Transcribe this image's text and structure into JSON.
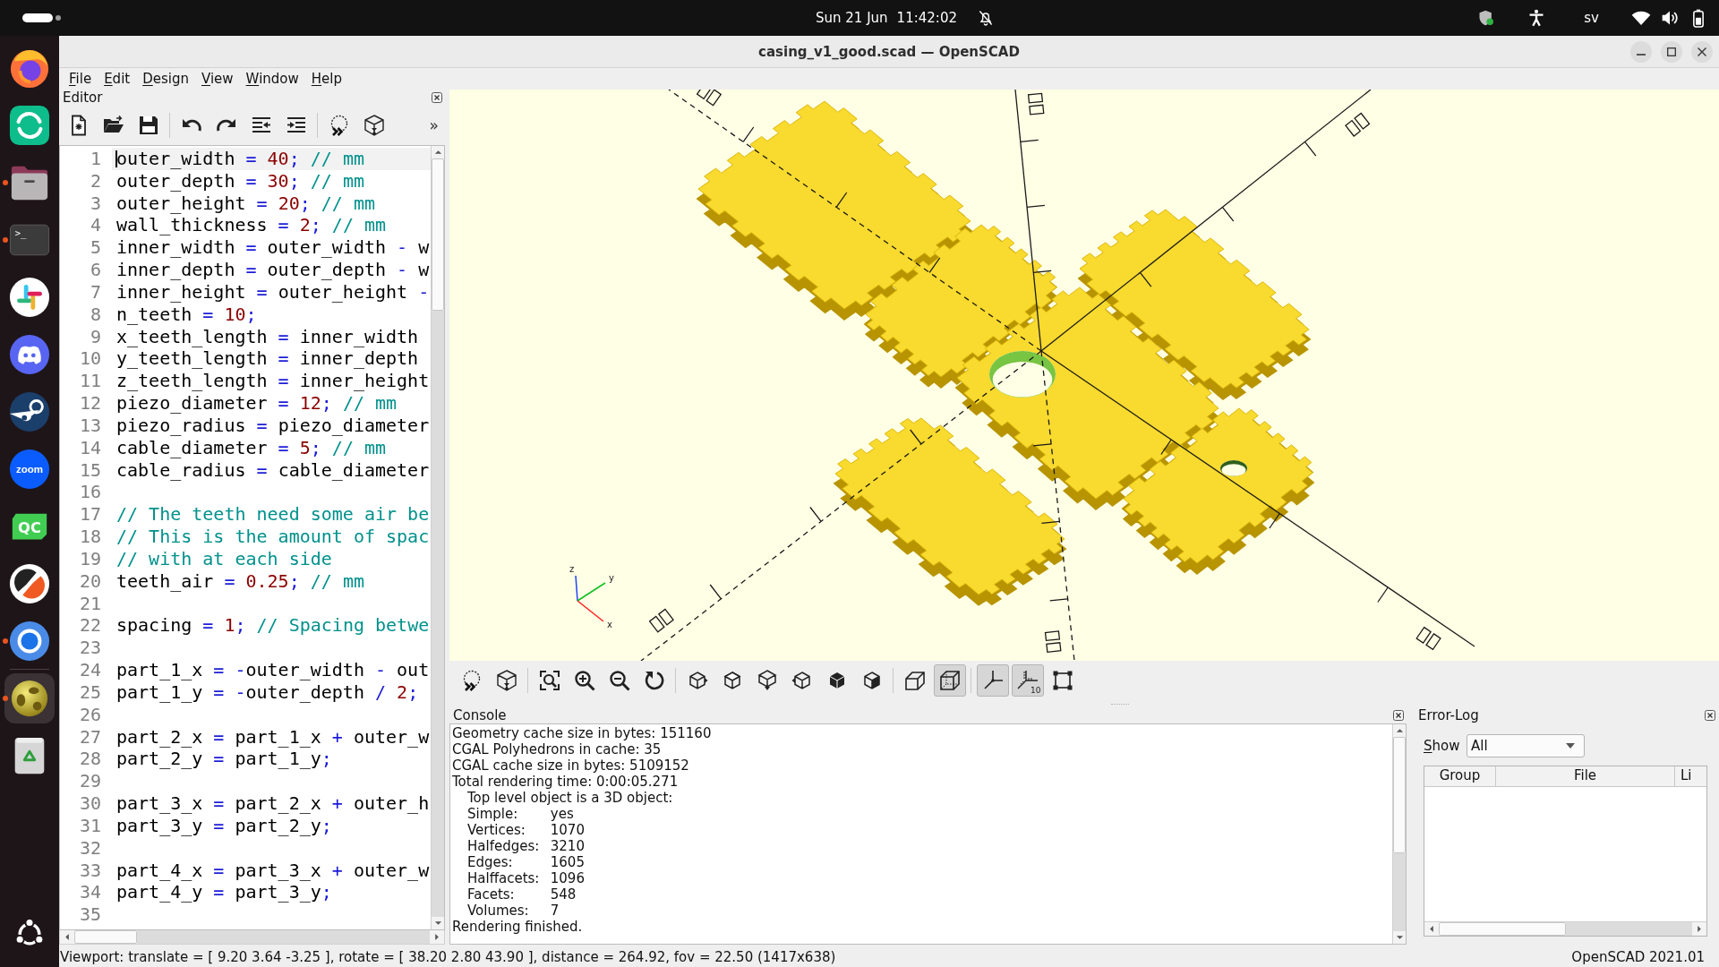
{
  "top_bar": {
    "date": "Sun 21 Jun",
    "time": "11:42:02",
    "keyboard_layout": "sv"
  },
  "dock": [
    {
      "kind": "flame",
      "running": false,
      "selected": false
    },
    {
      "kind": "rings",
      "running": false,
      "selected": false
    },
    {
      "kind": "folder",
      "running": true,
      "selected": false
    },
    {
      "kind": "terminal",
      "label": ">_",
      "running": true,
      "selected": false
    },
    {
      "kind": "pinwheel",
      "running": false,
      "selected": false
    },
    {
      "kind": "gamepad",
      "running": false,
      "selected": false
    },
    {
      "kind": "piston",
      "running": false,
      "selected": false
    },
    {
      "kind": "bubble",
      "label": "zoom",
      "running": false,
      "selected": false
    },
    {
      "kind": "flag",
      "label": "QC",
      "running": false,
      "selected": false
    },
    {
      "kind": "halfdisc",
      "running": false,
      "selected": false
    },
    {
      "kind": "orb",
      "running": true,
      "selected": false
    },
    {
      "kind": "sphere",
      "running": true,
      "selected": true
    },
    {
      "kind": "trash",
      "running": false,
      "selected": false
    }
  ],
  "window": {
    "title": "casing_v1_good.scad — OpenSCAD"
  },
  "menu": [
    "File",
    "Edit",
    "Design",
    "View",
    "Window",
    "Help"
  ],
  "editor": {
    "title": "Editor",
    "toolbar": [
      {
        "buttons": [
          {
            "kind": "new"
          },
          {
            "kind": "open"
          },
          {
            "kind": "save"
          }
        ]
      },
      {
        "buttons": [
          {
            "kind": "undo"
          },
          {
            "kind": "redo"
          },
          {
            "kind": "unindent"
          },
          {
            "kind": "indent"
          }
        ]
      },
      {
        "buttons": [
          {
            "kind": "preview"
          },
          {
            "kind": "render"
          }
        ]
      }
    ],
    "overflow": "»",
    "lines": [
      {
        "number": "1",
        "current": true,
        "tokens": [
          {
            "kind": "plain",
            "text": "outer_width"
          },
          {
            "kind": "op",
            "text": " = "
          },
          {
            "kind": "num",
            "text": "40"
          },
          {
            "kind": "op",
            "text": "; "
          },
          {
            "kind": "comment",
            "text": "// mm"
          }
        ]
      },
      {
        "number": "2",
        "current": false,
        "tokens": [
          {
            "kind": "plain",
            "text": "outer_depth"
          },
          {
            "kind": "op",
            "text": " = "
          },
          {
            "kind": "num",
            "text": "30"
          },
          {
            "kind": "op",
            "text": "; "
          },
          {
            "kind": "comment",
            "text": "// mm"
          }
        ]
      },
      {
        "number": "3",
        "current": false,
        "tokens": [
          {
            "kind": "plain",
            "text": "outer_height"
          },
          {
            "kind": "op",
            "text": " = "
          },
          {
            "kind": "num",
            "text": "20"
          },
          {
            "kind": "op",
            "text": "; "
          },
          {
            "kind": "comment",
            "text": "// mm"
          }
        ]
      },
      {
        "number": "4",
        "current": false,
        "tokens": [
          {
            "kind": "plain",
            "text": "wall_thickness"
          },
          {
            "kind": "op",
            "text": " = "
          },
          {
            "kind": "num",
            "text": "2"
          },
          {
            "kind": "op",
            "text": "; "
          },
          {
            "kind": "comment",
            "text": "// mm"
          }
        ]
      },
      {
        "number": "5",
        "current": false,
        "tokens": [
          {
            "kind": "plain",
            "text": "inner_width"
          },
          {
            "kind": "op",
            "text": " = "
          },
          {
            "kind": "plain",
            "text": "outer_width"
          },
          {
            "kind": "op",
            "text": " - "
          },
          {
            "kind": "plain",
            "text": "w"
          }
        ]
      },
      {
        "number": "6",
        "current": false,
        "tokens": [
          {
            "kind": "plain",
            "text": "inner_depth"
          },
          {
            "kind": "op",
            "text": " = "
          },
          {
            "kind": "plain",
            "text": "outer_depth"
          },
          {
            "kind": "op",
            "text": " - "
          },
          {
            "kind": "plain",
            "text": "w"
          }
        ]
      },
      {
        "number": "7",
        "current": false,
        "tokens": [
          {
            "kind": "plain",
            "text": "inner_height"
          },
          {
            "kind": "op",
            "text": " = "
          },
          {
            "kind": "plain",
            "text": "outer_height"
          },
          {
            "kind": "op",
            "text": " -"
          }
        ]
      },
      {
        "number": "8",
        "current": false,
        "tokens": [
          {
            "kind": "plain",
            "text": "n_teeth"
          },
          {
            "kind": "op",
            "text": " = "
          },
          {
            "kind": "num",
            "text": "10"
          },
          {
            "kind": "op",
            "text": ";"
          }
        ]
      },
      {
        "number": "9",
        "current": false,
        "tokens": [
          {
            "kind": "plain",
            "text": "x_teeth_length"
          },
          {
            "kind": "op",
            "text": " = "
          },
          {
            "kind": "plain",
            "text": "inner_width"
          }
        ]
      },
      {
        "number": "10",
        "current": false,
        "tokens": [
          {
            "kind": "plain",
            "text": "y_teeth_length"
          },
          {
            "kind": "op",
            "text": " = "
          },
          {
            "kind": "plain",
            "text": "inner_depth"
          }
        ]
      },
      {
        "number": "11",
        "current": false,
        "tokens": [
          {
            "kind": "plain",
            "text": "z_teeth_length"
          },
          {
            "kind": "op",
            "text": " = "
          },
          {
            "kind": "plain",
            "text": "inner_height"
          }
        ]
      },
      {
        "number": "12",
        "current": false,
        "tokens": [
          {
            "kind": "plain",
            "text": "piezo_diameter"
          },
          {
            "kind": "op",
            "text": " = "
          },
          {
            "kind": "num",
            "text": "12"
          },
          {
            "kind": "op",
            "text": "; "
          },
          {
            "kind": "comment",
            "text": "// mm"
          }
        ]
      },
      {
        "number": "13",
        "current": false,
        "tokens": [
          {
            "kind": "plain",
            "text": "piezo_radius"
          },
          {
            "kind": "op",
            "text": " = "
          },
          {
            "kind": "plain",
            "text": "piezo_diameter"
          }
        ]
      },
      {
        "number": "14",
        "current": false,
        "tokens": [
          {
            "kind": "plain",
            "text": "cable_diameter"
          },
          {
            "kind": "op",
            "text": " = "
          },
          {
            "kind": "num",
            "text": "5"
          },
          {
            "kind": "op",
            "text": "; "
          },
          {
            "kind": "comment",
            "text": "// mm"
          }
        ]
      },
      {
        "number": "15",
        "current": false,
        "tokens": [
          {
            "kind": "plain",
            "text": "cable_radius"
          },
          {
            "kind": "op",
            "text": " = "
          },
          {
            "kind": "plain",
            "text": "cable_diameter"
          }
        ]
      },
      {
        "number": "16",
        "current": false
      },
      {
        "number": "17",
        "current": false,
        "tokens": [
          {
            "kind": "comment",
            "text": "// The teeth need some air be"
          }
        ]
      },
      {
        "number": "18",
        "current": false,
        "tokens": [
          {
            "kind": "comment",
            "text": "// This is the amount of spac"
          }
        ]
      },
      {
        "number": "19",
        "current": false,
        "tokens": [
          {
            "kind": "comment",
            "text": "// with at each side"
          }
        ]
      },
      {
        "number": "20",
        "current": false,
        "tokens": [
          {
            "kind": "plain",
            "text": "teeth_air"
          },
          {
            "kind": "op",
            "text": " = "
          },
          {
            "kind": "num",
            "text": "0.25"
          },
          {
            "kind": "op",
            "text": "; "
          },
          {
            "kind": "comment",
            "text": "// mm"
          }
        ]
      },
      {
        "number": "21",
        "current": false
      },
      {
        "number": "22",
        "current": false,
        "tokens": [
          {
            "kind": "plain",
            "text": "spacing"
          },
          {
            "kind": "op",
            "text": " = "
          },
          {
            "kind": "num",
            "text": "1"
          },
          {
            "kind": "op",
            "text": "; "
          },
          {
            "kind": "comment",
            "text": "// Spacing betwe"
          }
        ]
      },
      {
        "number": "23",
        "current": false
      },
      {
        "number": "24",
        "current": false,
        "tokens": [
          {
            "kind": "plain",
            "text": "part_1_x"
          },
          {
            "kind": "op",
            "text": " = -"
          },
          {
            "kind": "plain",
            "text": "outer_width"
          },
          {
            "kind": "op",
            "text": " - "
          },
          {
            "kind": "plain",
            "text": "out"
          }
        ]
      },
      {
        "number": "25",
        "current": false,
        "tokens": [
          {
            "kind": "plain",
            "text": "part_1_y"
          },
          {
            "kind": "op",
            "text": " = -"
          },
          {
            "kind": "plain",
            "text": "outer_depth"
          },
          {
            "kind": "op",
            "text": " / "
          },
          {
            "kind": "num",
            "text": "2"
          },
          {
            "kind": "op",
            "text": ";"
          }
        ]
      },
      {
        "number": "26",
        "current": false
      },
      {
        "number": "27",
        "current": false,
        "tokens": [
          {
            "kind": "plain",
            "text": "part_2_x"
          },
          {
            "kind": "op",
            "text": " = "
          },
          {
            "kind": "plain",
            "text": "part_1_x"
          },
          {
            "kind": "op",
            "text": " + "
          },
          {
            "kind": "plain",
            "text": "outer_w"
          }
        ]
      },
      {
        "number": "28",
        "current": false,
        "tokens": [
          {
            "kind": "plain",
            "text": "part_2_y"
          },
          {
            "kind": "op",
            "text": " = "
          },
          {
            "kind": "plain",
            "text": "part_1_y"
          },
          {
            "kind": "op",
            "text": ";"
          }
        ]
      },
      {
        "number": "29",
        "current": false
      },
      {
        "number": "30",
        "current": false,
        "tokens": [
          {
            "kind": "plain",
            "text": "part_3_x"
          },
          {
            "kind": "op",
            "text": " = "
          },
          {
            "kind": "plain",
            "text": "part_2_x"
          },
          {
            "kind": "op",
            "text": " + "
          },
          {
            "kind": "plain",
            "text": "outer_h"
          }
        ]
      },
      {
        "number": "31",
        "current": false,
        "tokens": [
          {
            "kind": "plain",
            "text": "part_3_y"
          },
          {
            "kind": "op",
            "text": " = "
          },
          {
            "kind": "plain",
            "text": "part_2_y"
          },
          {
            "kind": "op",
            "text": ";"
          }
        ]
      },
      {
        "number": "32",
        "current": false
      },
      {
        "number": "33",
        "current": false,
        "tokens": [
          {
            "kind": "plain",
            "text": "part_4_x"
          },
          {
            "kind": "op",
            "text": " = "
          },
          {
            "kind": "plain",
            "text": "part_3_x"
          },
          {
            "kind": "op",
            "text": " + "
          },
          {
            "kind": "plain",
            "text": "outer_w"
          }
        ]
      },
      {
        "number": "34",
        "current": false,
        "tokens": [
          {
            "kind": "plain",
            "text": "part_4_y"
          },
          {
            "kind": "op",
            "text": " = "
          },
          {
            "kind": "plain",
            "text": "part_3_y"
          },
          {
            "kind": "op",
            "text": ";"
          }
        ]
      },
      {
        "number": "35",
        "current": false
      }
    ]
  },
  "viewport": {
    "axis_labels": [
      "z",
      "y",
      "x"
    ]
  },
  "view_toolbar": [
    {
      "buttons": [
        {
          "kind": "preview"
        },
        {
          "kind": "render"
        }
      ]
    },
    {
      "buttons": [
        {
          "kind": "viewall"
        },
        {
          "kind": "zoomin"
        },
        {
          "kind": "zoomout"
        },
        {
          "kind": "reset"
        }
      ]
    },
    {
      "buttons": [
        {
          "kind": "right"
        },
        {
          "kind": "top"
        },
        {
          "kind": "bottom"
        },
        {
          "kind": "left"
        },
        {
          "kind": "front"
        },
        {
          "kind": "back"
        }
      ]
    },
    {
      "buttons": [
        {
          "kind": "perspective",
          "selected": false
        },
        {
          "kind": "orthogonal",
          "selected": true
        }
      ]
    },
    {
      "buttons": [
        {
          "kind": "axes",
          "on": true
        },
        {
          "kind": "scale",
          "on": true,
          "label": "10"
        },
        {
          "kind": "edges",
          "on": false
        }
      ]
    }
  ],
  "console": {
    "title": "Console",
    "lines": [
      {
        "kind": "text",
        "text": "Geometry cache size in bytes: 151160"
      },
      {
        "kind": "text",
        "text": "CGAL Polyhedrons in cache: 35"
      },
      {
        "kind": "text",
        "text": "CGAL cache size in bytes: 5109152"
      },
      {
        "kind": "text",
        "text": "Total rendering time: 0:00:05.271"
      },
      {
        "kind": "indent",
        "text": "Top level object is a 3D object:"
      },
      {
        "kind": "stat",
        "label": "Simple:",
        "value": "yes"
      },
      {
        "kind": "stat",
        "label": "Vertices:",
        "value": "1070"
      },
      {
        "kind": "stat",
        "label": "Halfedges:",
        "value": "3210"
      },
      {
        "kind": "stat",
        "label": "Edges:",
        "value": "1605"
      },
      {
        "kind": "stat",
        "label": "Halffacets:",
        "value": "1096"
      },
      {
        "kind": "stat",
        "label": "Facets:",
        "value": "548"
      },
      {
        "kind": "stat",
        "label": "Volumes:",
        "value": "7"
      },
      {
        "kind": "text",
        "text": "Rendering finished."
      }
    ]
  },
  "error_log": {
    "title": "Error-Log",
    "show_label": "Show",
    "show_value": "All",
    "columns": [
      "Group",
      "File",
      "Li"
    ]
  },
  "status_bar": {
    "viewport": "Viewport: translate = [ 9.20 3.64 -3.25 ], rotate = [ 38.20 2.80 43.90 ], distance = 264.92, fov = 22.50 (1417x638)",
    "version": "OpenSCAD 2021.01"
  }
}
